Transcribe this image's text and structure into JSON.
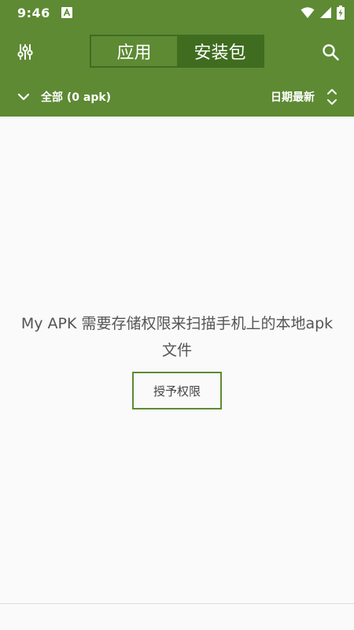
{
  "status_bar": {
    "time": "9:46",
    "notification_icon": "a-notification-icon",
    "icons": [
      "wifi-icon",
      "cell-signal-icon",
      "battery-icon"
    ]
  },
  "toolbar": {
    "filter_icon": "sliders-icon",
    "tabs": [
      {
        "label": "应用",
        "active": false
      },
      {
        "label": "安装包",
        "active": true
      }
    ],
    "search_icon": "search-icon"
  },
  "subbar": {
    "filter_label": "全部 (0 apk)",
    "sort_label": "日期最新",
    "expand_icon": "chevron-down-icon",
    "sort_icon": "unfold-icon"
  },
  "main": {
    "message": "My APK 需要存储权限来扫描手机上的本地apk文件",
    "grant_button": "授予权限"
  },
  "colors": {
    "primary": "#5d8a33",
    "primary_dark": "#3f6c1f",
    "background": "#fafafa"
  }
}
